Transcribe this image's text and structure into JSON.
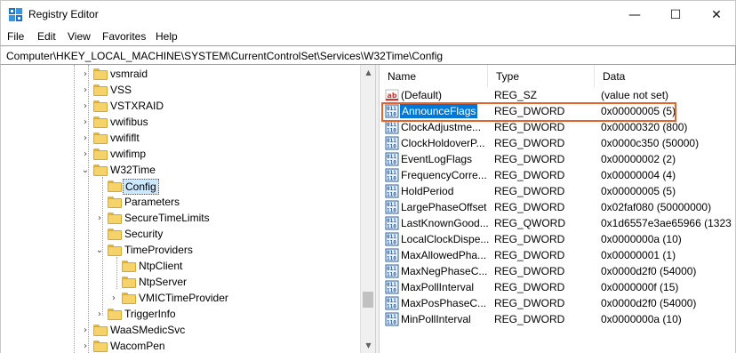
{
  "window": {
    "title": "Registry Editor",
    "controls": {
      "minimize": "—",
      "maximize": "☐",
      "close": "✕"
    }
  },
  "menu": [
    "File",
    "Edit",
    "View",
    "Favorites",
    "Help"
  ],
  "address": "Computer\\HKEY_LOCAL_MACHINE\\SYSTEM\\CurrentControlSet\\Services\\W32Time\\Config",
  "tree": [
    {
      "label": "vsmraid",
      "depth": 0,
      "expander": "›",
      "selected": false
    },
    {
      "label": "VSS",
      "depth": 0,
      "expander": "›",
      "selected": false
    },
    {
      "label": "VSTXRAID",
      "depth": 0,
      "expander": "›",
      "selected": false
    },
    {
      "label": "vwifibus",
      "depth": 0,
      "expander": "›",
      "selected": false
    },
    {
      "label": "vwififlt",
      "depth": 0,
      "expander": "›",
      "selected": false
    },
    {
      "label": "vwifimp",
      "depth": 0,
      "expander": "›",
      "selected": false
    },
    {
      "label": "W32Time",
      "depth": 0,
      "expander": "⌄",
      "selected": false
    },
    {
      "label": "Config",
      "depth": 1,
      "expander": "",
      "selected": true
    },
    {
      "label": "Parameters",
      "depth": 1,
      "expander": "",
      "selected": false
    },
    {
      "label": "SecureTimeLimits",
      "depth": 1,
      "expander": "›",
      "selected": false
    },
    {
      "label": "Security",
      "depth": 1,
      "expander": "",
      "selected": false
    },
    {
      "label": "TimeProviders",
      "depth": 1,
      "expander": "⌄",
      "selected": false
    },
    {
      "label": "NtpClient",
      "depth": 2,
      "expander": "",
      "selected": false
    },
    {
      "label": "NtpServer",
      "depth": 2,
      "expander": "",
      "selected": false
    },
    {
      "label": "VMICTimeProvider",
      "depth": 2,
      "expander": "›",
      "selected": false
    },
    {
      "label": "TriggerInfo",
      "depth": 1,
      "expander": "›",
      "selected": false
    },
    {
      "label": "WaaSMedicSvc",
      "depth": 0,
      "expander": "›",
      "selected": false
    },
    {
      "label": "WacomPen",
      "depth": 0,
      "expander": "›",
      "selected": false
    }
  ],
  "columns": [
    "Name",
    "Type",
    "Data"
  ],
  "values": [
    {
      "name": "(Default)",
      "type": "REG_SZ",
      "data": "(value not set)",
      "icon": "string-value-icon",
      "selected": false
    },
    {
      "name": "AnnounceFlags",
      "type": "REG_DWORD",
      "data": "0x00000005 (5)",
      "icon": "binary-value-icon",
      "selected": true
    },
    {
      "name": "ClockAdjustme...",
      "type": "REG_DWORD",
      "data": "0x00000320 (800)",
      "icon": "binary-value-icon",
      "selected": false
    },
    {
      "name": "ClockHoldoverP...",
      "type": "REG_DWORD",
      "data": "0x0000c350 (50000)",
      "icon": "binary-value-icon",
      "selected": false
    },
    {
      "name": "EventLogFlags",
      "type": "REG_DWORD",
      "data": "0x00000002 (2)",
      "icon": "binary-value-icon",
      "selected": false
    },
    {
      "name": "FrequencyCorre...",
      "type": "REG_DWORD",
      "data": "0x00000004 (4)",
      "icon": "binary-value-icon",
      "selected": false
    },
    {
      "name": "HoldPeriod",
      "type": "REG_DWORD",
      "data": "0x00000005 (5)",
      "icon": "binary-value-icon",
      "selected": false
    },
    {
      "name": "LargePhaseOffset",
      "type": "REG_DWORD",
      "data": "0x02faf080 (50000000)",
      "icon": "binary-value-icon",
      "selected": false
    },
    {
      "name": "LastKnownGood...",
      "type": "REG_QWORD",
      "data": "0x1d6557e3ae65966 (1323",
      "icon": "binary-value-icon",
      "selected": false
    },
    {
      "name": "LocalClockDispe...",
      "type": "REG_DWORD",
      "data": "0x0000000a (10)",
      "icon": "binary-value-icon",
      "selected": false
    },
    {
      "name": "MaxAllowedPha...",
      "type": "REG_DWORD",
      "data": "0x00000001 (1)",
      "icon": "binary-value-icon",
      "selected": false
    },
    {
      "name": "MaxNegPhaseC...",
      "type": "REG_DWORD",
      "data": "0x0000d2f0 (54000)",
      "icon": "binary-value-icon",
      "selected": false
    },
    {
      "name": "MaxPollInterval",
      "type": "REG_DWORD",
      "data": "0x0000000f (15)",
      "icon": "binary-value-icon",
      "selected": false
    },
    {
      "name": "MaxPosPhaseC...",
      "type": "REG_DWORD",
      "data": "0x0000d2f0 (54000)",
      "icon": "binary-value-icon",
      "selected": false
    },
    {
      "name": "MinPollInterval",
      "type": "REG_DWORD",
      "data": "0x0000000a (10)",
      "icon": "binary-value-icon",
      "selected": false
    }
  ],
  "colors": {
    "selection": "#0078d7",
    "highlight": "#e8622c",
    "folder": "#f6d26a"
  }
}
